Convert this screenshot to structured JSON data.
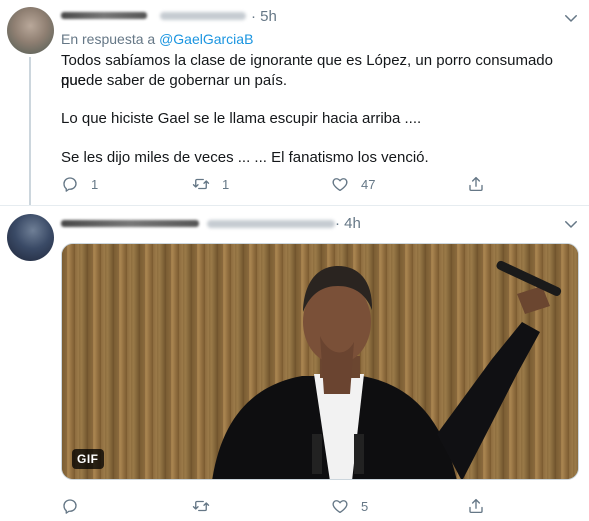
{
  "tweets": [
    {
      "time": "· 5h",
      "reply_prefix": "En respuesta a ",
      "reply_mention": "@GaelGarciaB",
      "lines": [
        "Todos sabíamos la clase de ignorante que es López, un porro consumado que",
        "puede saber de gobernar un país.",
        "Lo que hiciste Gael se le llama escupir hacia arriba ....",
        "Se les dijo miles de veces ... ... El fanatismo los venció."
      ],
      "reply_count": "1",
      "retweet_count": "1",
      "like_count": "47"
    },
    {
      "time": "· 4h",
      "media_badge": "GIF",
      "reply_count": "",
      "retweet_count": "",
      "like_count": "5"
    }
  ],
  "icons": {
    "reply": "reply-icon",
    "retweet": "retweet-icon",
    "like": "like-icon",
    "share": "share-icon",
    "caret": "chevron-down-icon"
  },
  "colors": {
    "link": "#1b95e0",
    "muted": "#657786",
    "text": "#14171a"
  }
}
